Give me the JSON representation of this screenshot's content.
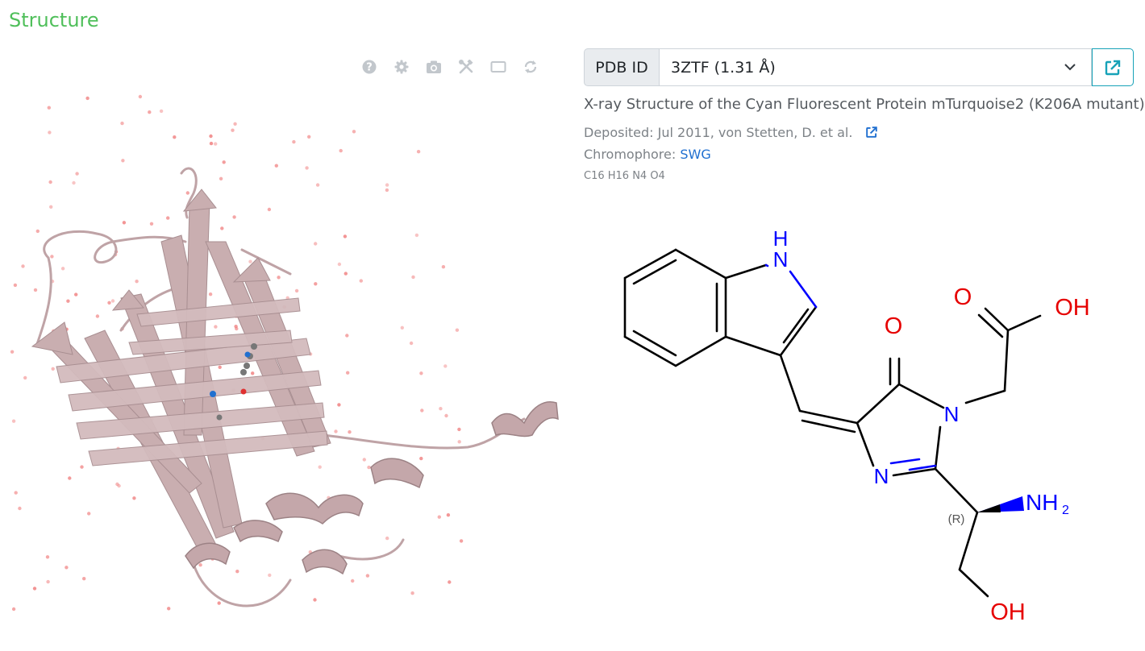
{
  "section": {
    "title": "Structure"
  },
  "toolbar": {
    "buttons": [
      {
        "name": "help-icon"
      },
      {
        "name": "settings-icon"
      },
      {
        "name": "camera-icon"
      },
      {
        "name": "tools-icon"
      },
      {
        "name": "fullscreen-icon"
      },
      {
        "name": "spin-icon"
      }
    ]
  },
  "pdb": {
    "label": "PDB ID",
    "selected": "3ZTF (1.31 Å)"
  },
  "structure": {
    "title": "X-ray Structure of the Cyan Fluorescent Protein mTurquoise2 (K206A mutant)",
    "deposited_label": "Deposited: ",
    "deposited_value": "Jul 2011, von Stetten, D. et al.",
    "chromophore_label": "Chromophore: ",
    "chromophore_value": "SWG",
    "formula": "C16 H16 N4 O4"
  },
  "molecule": {
    "atoms": [
      "H",
      "N",
      "O",
      "OH",
      "O",
      "N",
      "N",
      "(R)",
      "NH",
      "2",
      "OH"
    ]
  },
  "colors": {
    "title_green": "#4fbf5a",
    "link_blue": "#1f6fd0",
    "teal": "#17a2b8",
    "ribbon": "#c9aeb0",
    "nitrogen": "#0000ff",
    "oxygen": "#e60000"
  }
}
